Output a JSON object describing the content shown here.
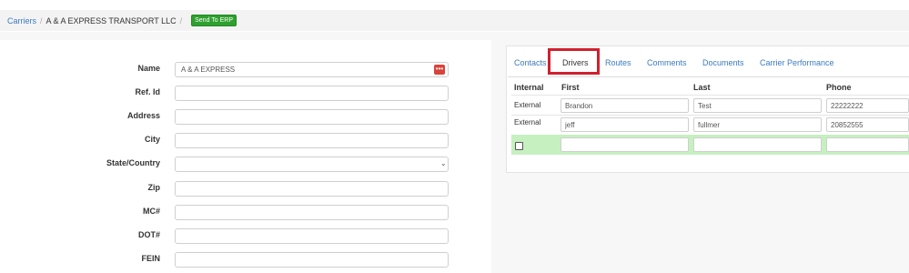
{
  "breadcrumb": {
    "root": "Carriers",
    "separator": "/",
    "current": "A & A EXPRESS TRANSPORT LLC",
    "send_button": "Send To ERP"
  },
  "form": {
    "name_label": "Name",
    "name_value": "A & A EXPRESS",
    "name_addon": "•••",
    "refid_label": "Ref. Id",
    "address_label": "Address",
    "city_label": "City",
    "state_label": "State/Country",
    "state_chevron": "⌄",
    "zip_label": "Zip",
    "mc_label": "MC#",
    "dot_label": "DOT#",
    "fein_label": "FEIN"
  },
  "tabs": {
    "contacts": "Contacts",
    "drivers": "Drivers",
    "routes": "Routes",
    "comments": "Comments",
    "documents": "Documents",
    "performance": "Carrier Performance"
  },
  "drivers_table": {
    "headers": {
      "internal": "Internal",
      "first": "First",
      "last": "Last",
      "phone": "Phone"
    },
    "rows": [
      {
        "internal": "External",
        "first": "Brandon",
        "last": "Test",
        "phone": "22222222"
      },
      {
        "internal": "External",
        "first": "jeff",
        "last": "fullmer",
        "phone": "20852555"
      }
    ]
  },
  "colors": {
    "link": "#3b7bbf",
    "erp_button": "#2fa02f",
    "highlight_box": "#d0202f",
    "new_row": "#c6f0c0",
    "name_addon": "#d9433a"
  }
}
